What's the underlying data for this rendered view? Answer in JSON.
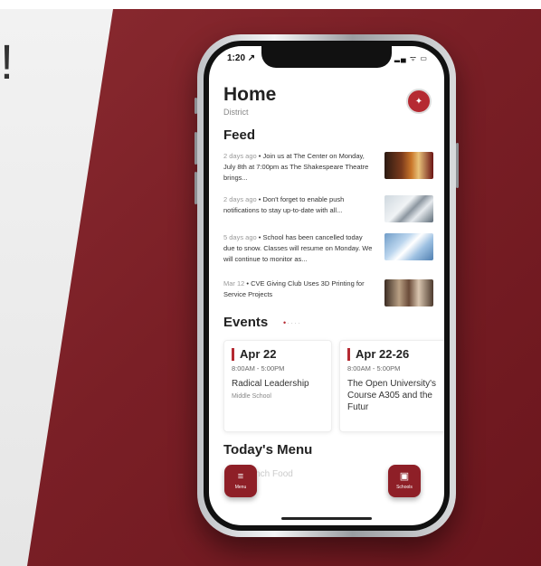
{
  "background": {
    "headline_fragment": "!"
  },
  "status_bar": {
    "time": "1:20 ↗",
    "icons": "▂▄ ᯤ ▭"
  },
  "header": {
    "title": "Home",
    "subtitle": "District"
  },
  "feed": {
    "title": "Feed",
    "items": [
      {
        "meta": "2 days ago",
        "text": " • Join us at The Center on Monday, July 8th at 7:00pm as The Shakespeare Theatre brings..."
      },
      {
        "meta": "2 days ago",
        "text": " • Don't forget to enable push notifications to stay up-to-date with all..."
      },
      {
        "meta": "5 days ago",
        "text": " • School has been cancelled today due to snow. Classes will resume on Monday. We will continue to monitor as..."
      },
      {
        "meta": "Mar 12",
        "text": " • CVE Giving Club Uses 3D Printing for Service Projects"
      }
    ]
  },
  "events": {
    "title": "Events",
    "dots": "•····",
    "items": [
      {
        "date": "Apr 22",
        "time": "8:00AM - 5:00PM",
        "name": "Radical Leadership",
        "location": "Middle School"
      },
      {
        "date": "Apr 22-26",
        "time": "8:00AM - 5:00PM",
        "name": "The Open University's Course A305 and the Futur",
        "location": ""
      }
    ]
  },
  "menu": {
    "title": "Today's Menu",
    "faded_text": "Lunch Food"
  },
  "fab": {
    "menu_label": "Menu",
    "menu_icon": "≡",
    "schools_label": "Schools",
    "schools_icon": "▣"
  },
  "colors": {
    "brand": "#8e1f27",
    "accent": "#b52a32"
  }
}
